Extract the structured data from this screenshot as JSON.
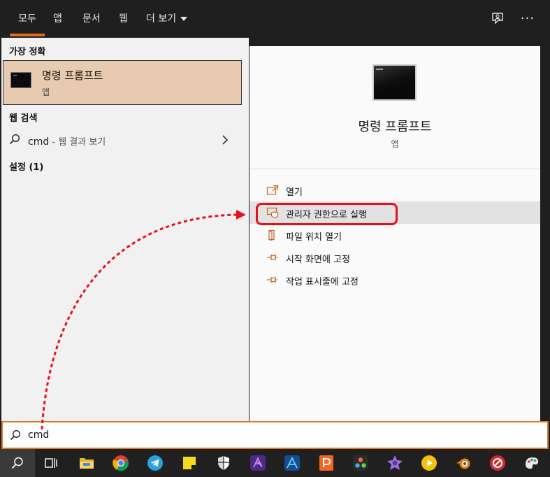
{
  "tabs": {
    "all": "모두",
    "apps": "앱",
    "documents": "문서",
    "web": "웹",
    "more": "더 보기"
  },
  "left": {
    "best_match_heading": "가장 정확",
    "best_match": {
      "title": "명령 프롬프트",
      "subtitle": "앱"
    },
    "web_search_heading": "웹 검색",
    "web_search": {
      "query": "cmd",
      "separator": " - ",
      "suffix": "웹 결과 보기"
    },
    "settings_heading": "설정 (1)"
  },
  "detail": {
    "title": "명령 프롬프트",
    "subtitle": "앱",
    "actions": [
      {
        "label": "열기",
        "icon": "open-icon"
      },
      {
        "label": "관리자 권한으로 실행",
        "icon": "shield-icon"
      },
      {
        "label": "파일 위치 열기",
        "icon": "file-location-icon"
      },
      {
        "label": "시작 화면에 고정",
        "icon": "pin-icon"
      },
      {
        "label": "작업 표시줄에 고정",
        "icon": "pin-icon"
      }
    ]
  },
  "search": {
    "value": "cmd"
  },
  "colors": {
    "accent": "#e06d1f",
    "highlight_box": "#e8101a",
    "best_match_bg": "#e8cab1",
    "annotation_arrow": "#e8101a"
  },
  "taskbar_icons": [
    "search-icon",
    "task-view-icon",
    "file-explorer-icon",
    "chrome-icon",
    "telegram-icon",
    "sticky-notes-icon",
    "shield-app-icon",
    "affinity-photo-icon",
    "affinity-designer-icon",
    "powerpoint-icon",
    "davinci-resolve-icon",
    "affinity-publisher-icon",
    "media-player-icon",
    "blender-icon",
    "red-app-icon",
    "paint-icon"
  ]
}
